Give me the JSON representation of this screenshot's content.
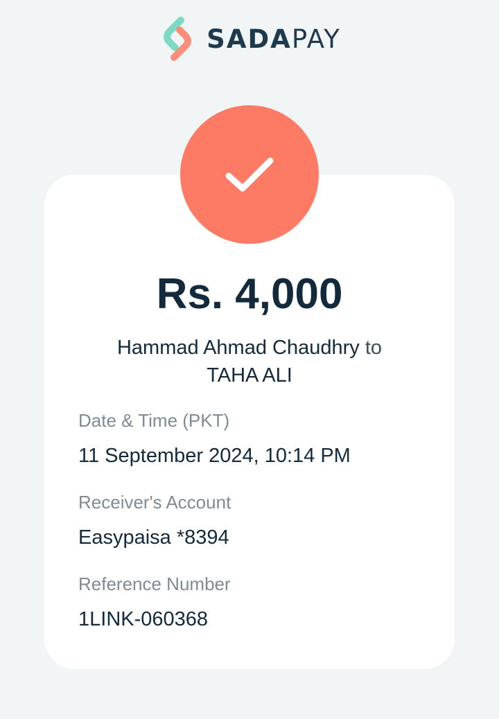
{
  "brand": {
    "name_bold": "SADA",
    "name_light": "PAY"
  },
  "status": {
    "icon": "checkmark-icon",
    "color": "#fd7b64"
  },
  "transaction": {
    "amount": "Rs. 4,000",
    "sender": "Hammad Ahmad Chaudhry",
    "connector": "to",
    "receiver": "TAHA ALI"
  },
  "details": [
    {
      "label": "Date & Time (PKT)",
      "value": "11 September 2024, 10:14 PM"
    },
    {
      "label": "Receiver's Account",
      "value": "Easypaisa *8394"
    },
    {
      "label": "Reference Number",
      "value": "1LINK-060368"
    }
  ],
  "colors": {
    "background": "#f1f5f6",
    "accent": "#fd7b64",
    "logo_teal": "#6fd7bf",
    "text_dark": "#122a3b",
    "text_muted": "#7f8b94"
  }
}
